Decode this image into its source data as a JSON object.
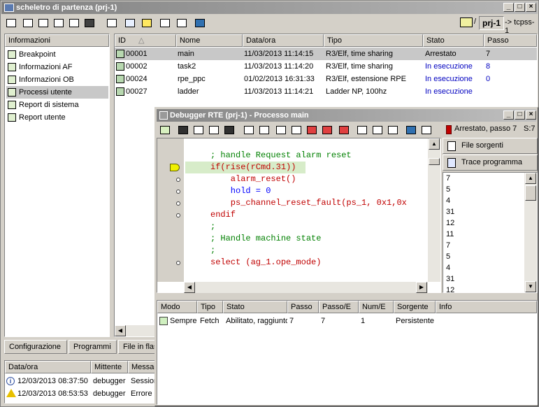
{
  "main_window": {
    "title": "scheletro di partenza (prj-1)",
    "project_label": "prj-1",
    "target_label": "-> tcpss-1"
  },
  "info_panel": {
    "header": "Informazioni",
    "items": [
      "Breakpoint",
      "Informazioni AF",
      "Informazioni OB",
      "Processi utente",
      "Report di sistema",
      "Report utente"
    ],
    "selected": "Processi utente"
  },
  "process_table": {
    "columns": [
      "ID",
      "Nome",
      "Data/ora",
      "Tipo",
      "Stato",
      "Passo"
    ],
    "rows": [
      {
        "id": "00001",
        "name": "main",
        "datetime": "11/03/2013 11:14:15",
        "type": "R3/Elf, time sharing",
        "state": "Arrestato",
        "step": "7"
      },
      {
        "id": "00002",
        "name": "task2",
        "datetime": "11/03/2013 11:14:20",
        "type": "R3/Elf, time sharing",
        "state": "In esecuzione",
        "step": "8"
      },
      {
        "id": "00024",
        "name": "rpe_ppc",
        "datetime": "01/02/2013 16:31:33",
        "type": "R3/Elf, estensione RPE",
        "state": "In esecuzione",
        "step": "0"
      },
      {
        "id": "00027",
        "name": "ladder",
        "datetime": "11/03/2013 11:14:21",
        "type": "Ladder NP, 100hz",
        "state": "In esecuzione",
        "step": ""
      }
    ]
  },
  "bottom_tabs": [
    "Configurazione",
    "Programmi",
    "File in flash"
  ],
  "log_table": {
    "columns": [
      "Data/ora",
      "Mittente",
      "Messaggio"
    ],
    "rows": [
      {
        "level": "info",
        "datetime": "12/03/2013 08:37:50",
        "sender": "debugger",
        "message": "Sessione"
      },
      {
        "level": "warning",
        "datetime": "12/03/2013 08:53:53",
        "sender": "debugger",
        "message": "Errore i"
      }
    ]
  },
  "debugger": {
    "title": "Debugger RTE (prj-1) - Processo main",
    "status": "Arrestato, passo 7",
    "status_extra": "S:7",
    "code_lines": [
      {
        "text": "",
        "kind": "plain",
        "marker": ""
      },
      {
        "text": "; handle Request alarm reset",
        "kind": "comment",
        "marker": ""
      },
      {
        "text": "if(rise(rCmd.31))",
        "kind": "if",
        "marker": "current"
      },
      {
        "text": "    alarm_reset()",
        "kind": "call",
        "marker": "dot"
      },
      {
        "text": "    hold = 0",
        "kind": "assign",
        "marker": "dot"
      },
      {
        "text": "    ps_channel_reset_fault(ps_1, 0x1,0x",
        "kind": "call2",
        "marker": "dot"
      },
      {
        "text": "endif",
        "kind": "kw",
        "marker": "dot"
      },
      {
        "text": ";",
        "kind": "comment",
        "marker": ""
      },
      {
        "text": "; Handle machine state",
        "kind": "comment",
        "marker": ""
      },
      {
        "text": ";",
        "kind": "comment",
        "marker": ""
      },
      {
        "text": "select (ag_1.ope_mode)",
        "kind": "select",
        "marker": "dot"
      }
    ],
    "side_buttons": [
      "File sorgenti",
      "Trace programma"
    ],
    "trace_values": [
      "7",
      "5",
      "4",
      "31",
      "12",
      "11",
      "7",
      "5",
      "4",
      "31",
      "12"
    ],
    "bp_table": {
      "columns": [
        "Modo",
        "Tipo",
        "Stato",
        "Passo",
        "Passo/E",
        "Num/E",
        "Sorgente",
        "Info"
      ],
      "rows": [
        {
          "mode": "Sempre",
          "type": "Fetch",
          "state": "Abilitato, raggiunto",
          "step": "7",
          "step_e": "7",
          "num_e": "1",
          "source": "Persistente",
          "info": ""
        }
      ]
    }
  },
  "colors": {
    "selection": "#c8c8c8",
    "running_blue": "#0000c0",
    "highlight": "#d7ecc9"
  }
}
